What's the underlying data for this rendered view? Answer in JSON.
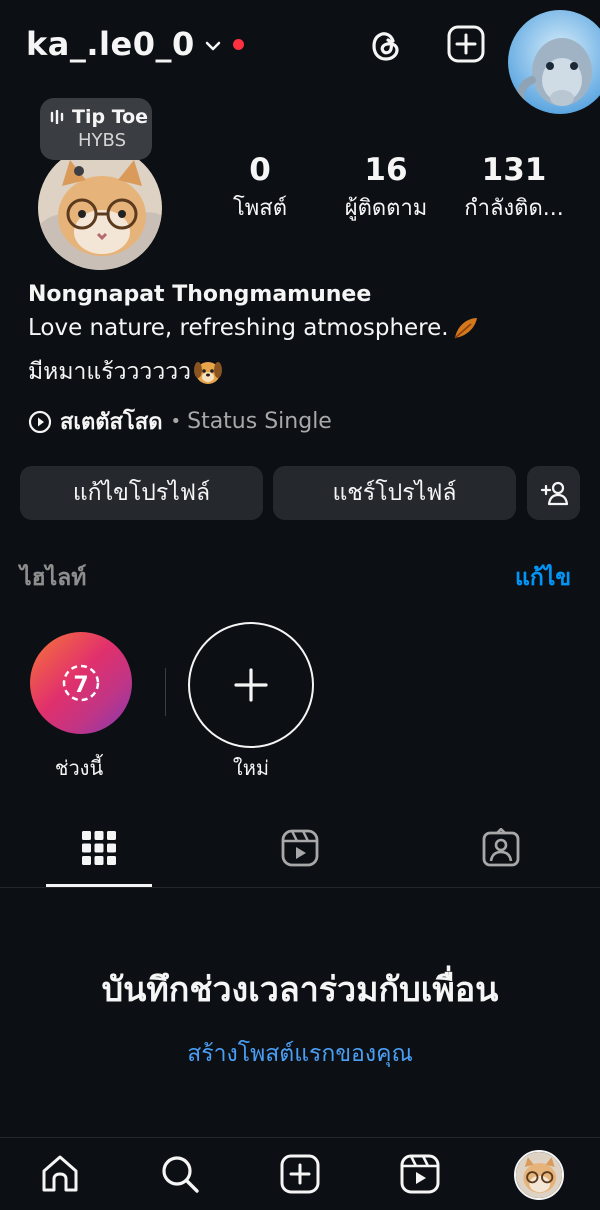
{
  "header": {
    "username": "ka_.le0_0"
  },
  "music_note": {
    "song": "Tip Toe",
    "artist": "HYBS"
  },
  "stats": [
    {
      "value": "0",
      "label": "โพสต์"
    },
    {
      "value": "16",
      "label": "ผู้ติดตาม"
    },
    {
      "value": "131",
      "label": "กำลังติด..."
    }
  ],
  "profile": {
    "full_name": "Nongnapat Thongmamunee",
    "bio_line1": "Love nature, refreshing atmosphere.",
    "bio_line2": "มีหมาแร้วววววว",
    "status_label": "สเตตัสโสด",
    "status_separator": "•",
    "status_text": "Status Single"
  },
  "actions": {
    "edit_profile": "แก้ไขโปรไฟล์",
    "share_profile": "แชร์โปรไฟล์"
  },
  "highlights": {
    "title": "ไฮไลท์",
    "edit": "แก้ไข",
    "items": [
      {
        "label": "ช่วงนี้",
        "badge": "7"
      },
      {
        "label": "ใหม่"
      }
    ]
  },
  "empty_state": {
    "title": "บันทึกช่วงเวลาร่วมกับเพื่อน",
    "link": "สร้างโพสต์แรกของคุณ"
  },
  "colors": {
    "background": "#0c1014",
    "button": "#25292e",
    "accent_link": "#0095f6",
    "notification_dot": "#ff3040"
  }
}
